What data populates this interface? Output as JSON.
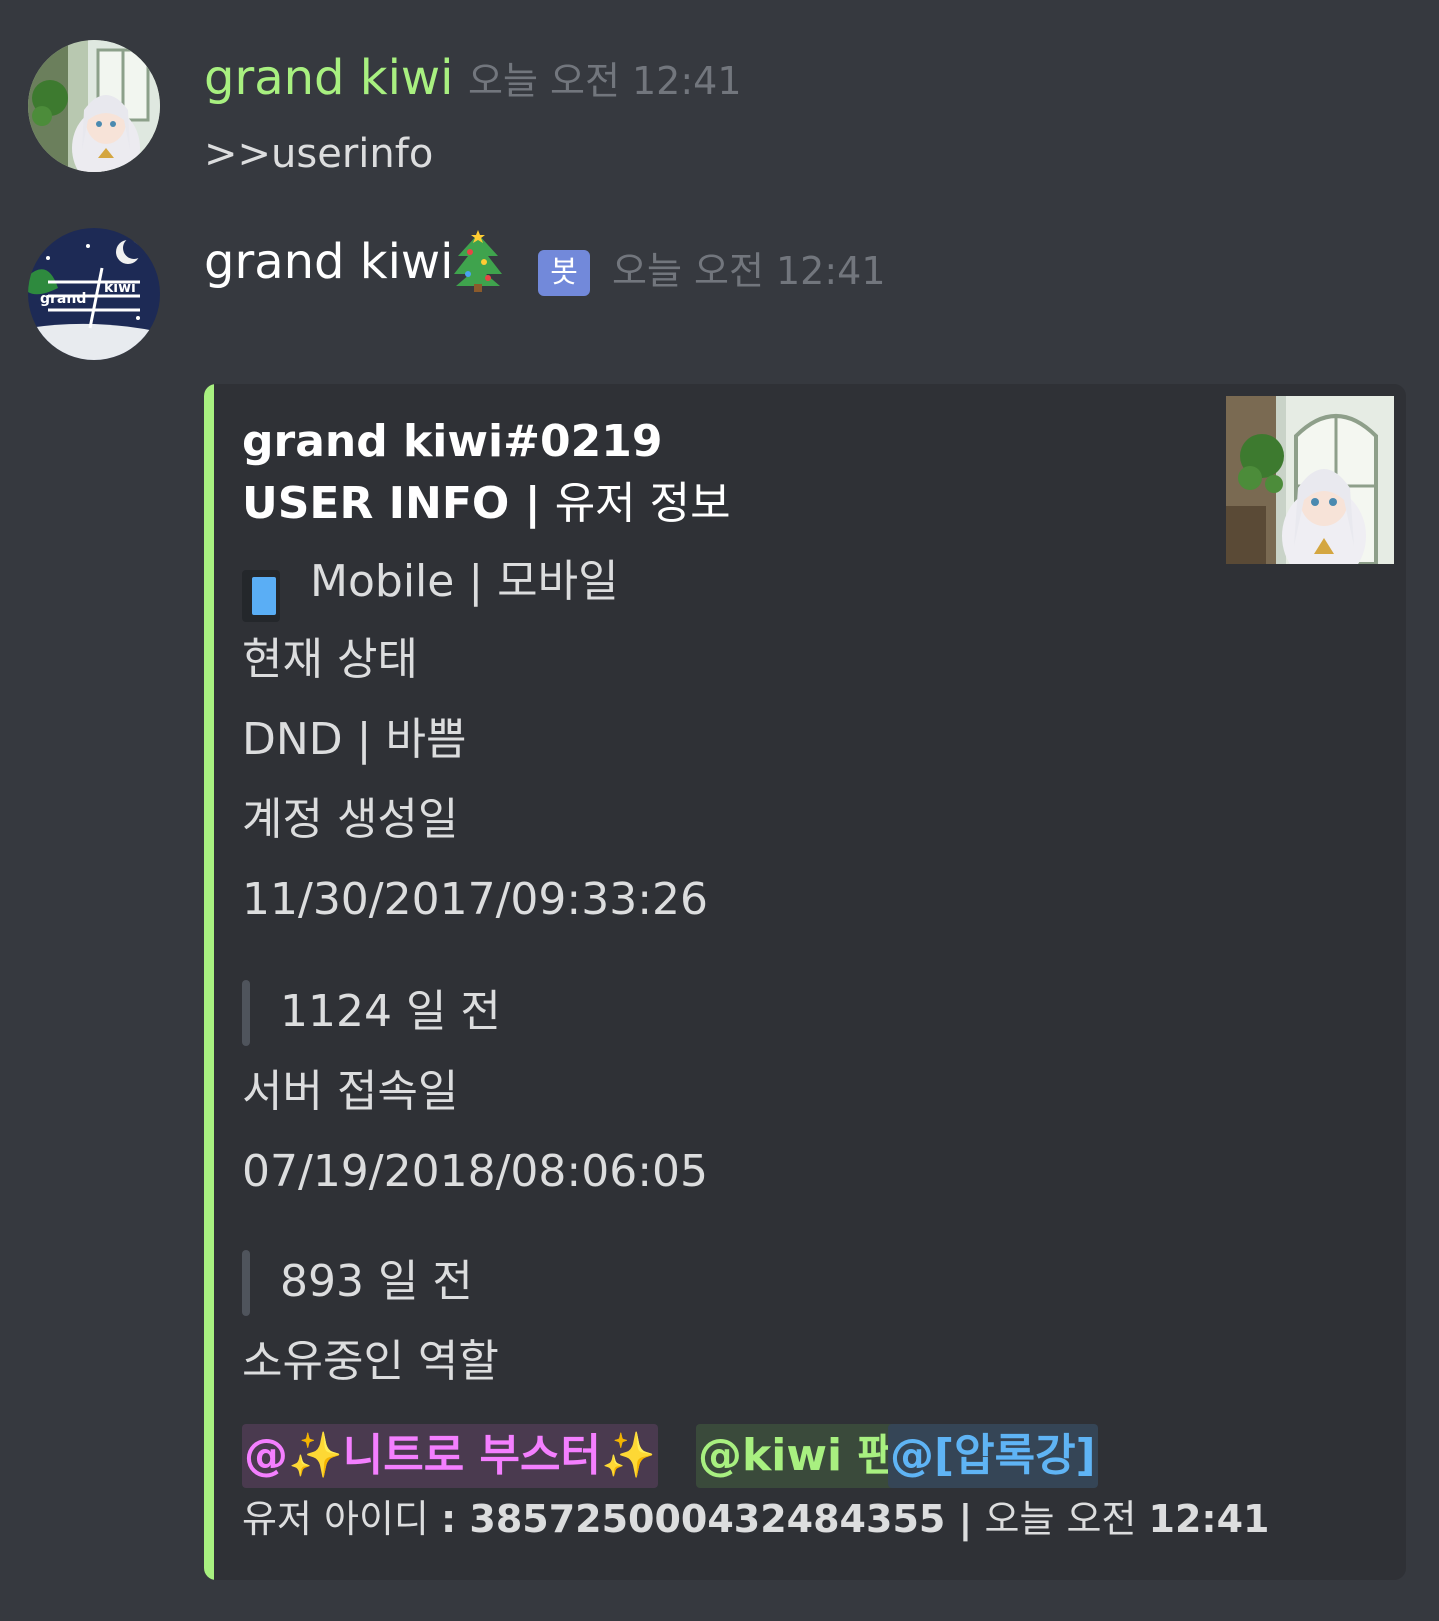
{
  "messages": [
    {
      "author": "grand kiwi",
      "author_color": "#a8f080",
      "timestamp": "오늘 오전 12:41",
      "content": ">>userinfo",
      "avatar_icon": "anime-girl-avatar"
    },
    {
      "author": "grand kiwi",
      "author_color": "#ffffff",
      "author_emoji": "🎄",
      "bot_tag": "봇",
      "timestamp": "오늘 오전 12:41",
      "avatar_icon": "grand-kiwi-logo-avatar",
      "avatar_text_left": "grand",
      "avatar_text_right": "kiwi"
    }
  ],
  "embed": {
    "accent_color": "#a8f080",
    "author_tag": "grand kiwi#0219",
    "title_bold": "USER INFO |",
    "title_rest": " 유저 정보",
    "device": "Mobile | 모바일",
    "status_label": "현재 상태",
    "status_value": "DND | 바쁨",
    "created_label": "계정 생성일",
    "created_value": "11/30/2017/09:33:26",
    "created_ago": "1124 일 전",
    "joined_label": "서버 접속일",
    "joined_value": "07/19/2018/08:06:05",
    "joined_ago": "893 일 전",
    "roles_label": "소유중인 역할",
    "roles": [
      {
        "label": "@✨니트로 부스터✨",
        "color": "#f47fff",
        "bg": "#4a3a4f"
      },
      {
        "label": "@kiwi 팬",
        "color": "#a8f080",
        "bg": "#3a4a3b"
      },
      {
        "label": "@[압록강]",
        "color": "#5fb4f5",
        "bg": "#354556"
      }
    ],
    "footer_label": "유저 아이디 ",
    "footer_id": ": 385725000432484355 |",
    "footer_time_prefix": " 오늘 오전 ",
    "footer_time": "12:41",
    "thumbnail_icon": "anime-girl-thumbnail"
  }
}
